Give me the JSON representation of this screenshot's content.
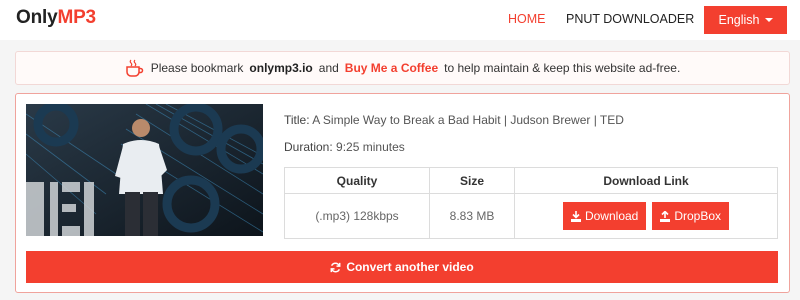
{
  "header": {
    "brand_part1": "Only",
    "brand_part2": "MP3",
    "nav": {
      "home": "HOME",
      "pnut": "PNUT DOWNLOADER"
    },
    "language": "English"
  },
  "notice": {
    "icon": "coffee-mug-icon",
    "prefix": "Please bookmark",
    "site": "onlymp3.io",
    "and": "and",
    "coffee_link": "Buy Me a Coffee",
    "suffix": "to help maintain & keep this website ad-free."
  },
  "video": {
    "title_label": "Title:",
    "title": "A Simple Way to Break a Bad Habit | Judson Brewer | TED",
    "duration_label": "Duration:",
    "duration": "9:25 minutes"
  },
  "table": {
    "headers": [
      "Quality",
      "Size",
      "Download Link"
    ],
    "rows": [
      {
        "quality": "(.mp3) 128kbps",
        "size": "8.83 MB",
        "download": "Download",
        "dropbox": "DropBox"
      }
    ]
  },
  "convert_label": "Convert another video",
  "colors": {
    "accent": "#f33f2f",
    "notice_border": "#f2d8d6",
    "card_border": "#f0a39c"
  }
}
